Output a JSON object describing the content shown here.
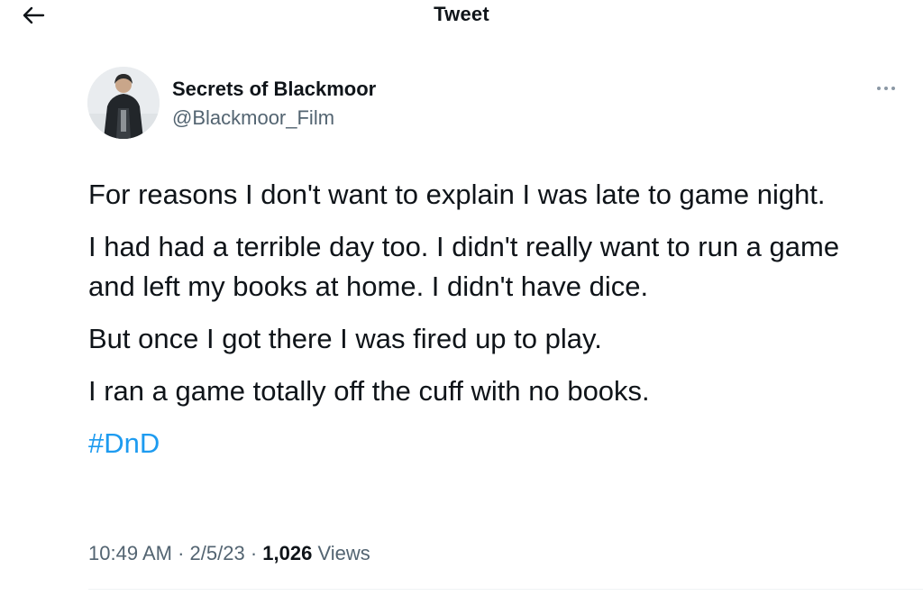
{
  "header": {
    "title": "Tweet",
    "back_icon": "arrow-left-icon"
  },
  "author": {
    "display_name": "Secrets of Blackmoor",
    "handle": "@Blackmoor_Film",
    "avatar": "profile-photo"
  },
  "more_icon": "more-horizontal-icon",
  "tweet": {
    "paragraphs": [
      "For reasons I don't want to explain I was late to game night.",
      "I had had a terrible day too. I didn't really want to run a game and left my books at home. I didn't have dice.",
      "But once I got there I was fired up to play.",
      "I ran a game totally off the cuff with no books."
    ],
    "hashtag": "#DnD",
    "time": "10:49 AM",
    "date": "2/5/23",
    "views_count": "1,026",
    "views_label": "Views"
  },
  "colors": {
    "link": "#1d9bf0",
    "text": "#0f1419",
    "secondary": "#536471"
  }
}
